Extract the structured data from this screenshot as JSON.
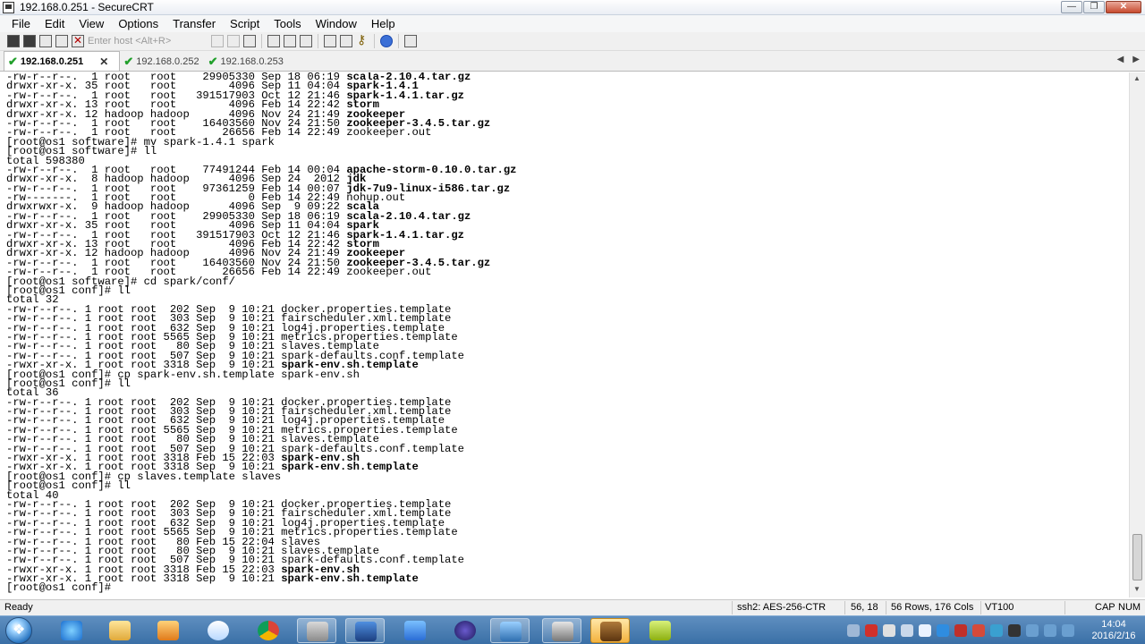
{
  "window": {
    "title": "192.168.0.251 - SecureCRT"
  },
  "window_controls": {
    "minimize": "—",
    "maximize": "❐",
    "close": "✕"
  },
  "menu": [
    "File",
    "Edit",
    "View",
    "Options",
    "Transfer",
    "Script",
    "Tools",
    "Window",
    "Help"
  ],
  "toolbar": {
    "host_placeholder": "Enter host <Alt+R>",
    "icons": [
      "connect-icon",
      "quick-connect-icon",
      "connect-in-tab-icon",
      "reconnect-icon",
      "disconnect-icon",
      "copy-icon",
      "paste-icon",
      "find-icon",
      "print-icon",
      "print-selection-icon",
      "print-setup-icon",
      "session-options-icon",
      "global-options-icon",
      "key-manager-icon",
      "help-icon",
      "map-icon"
    ]
  },
  "tabs": [
    {
      "label": "192.168.0.251",
      "active": true,
      "close": "✕"
    },
    {
      "label": "192.168.0.252",
      "active": false
    },
    {
      "label": "192.168.0.253",
      "active": false
    }
  ],
  "tab_nav": {
    "left": "◀",
    "right": "▶"
  },
  "terminal": {
    "lines": [
      [
        {
          "t": "-rw-r--r--.  1 root   root    29905330 Sep 18 06:19 "
        },
        {
          "t": "scala-2.10.4.tar.gz",
          "b": true
        }
      ],
      [
        {
          "t": "drwxr-xr-x. 35 root   root        4096 Sep 11 04:04 "
        },
        {
          "t": "spark-1.4.1",
          "b": true
        }
      ],
      [
        {
          "t": "-rw-r--r--.  1 root   root   391517903 Oct 12 21:46 "
        },
        {
          "t": "spark-1.4.1.tar.gz",
          "b": true
        }
      ],
      [
        {
          "t": "drwxr-xr-x. 13 root   root        4096 Feb 14 22:42 "
        },
        {
          "t": "storm",
          "b": true
        }
      ],
      [
        {
          "t": "drwxr-xr-x. 12 hadoop hadoop      4096 Nov 24 21:49 "
        },
        {
          "t": "zookeeper",
          "b": true
        }
      ],
      [
        {
          "t": "-rw-r--r--.  1 root   root    16403560 Nov 24 21:50 "
        },
        {
          "t": "zookeeper-3.4.5.tar.gz",
          "b": true
        }
      ],
      [
        {
          "t": "-rw-r--r--.  1 root   root       26656 Feb 14 22:49 zookeeper.out"
        }
      ],
      [
        {
          "t": "[root@os1 software]# mv spark-1.4.1 spark"
        }
      ],
      [
        {
          "t": "[root@os1 software]# ll"
        }
      ],
      [
        {
          "t": "total 598380"
        }
      ],
      [
        {
          "t": "-rw-r--r--.  1 root   root    77491244 Feb 14 00:04 "
        },
        {
          "t": "apache-storm-0.10.0.tar.gz",
          "b": true
        }
      ],
      [
        {
          "t": "drwxr-xr-x.  8 hadoop hadoop      4096 Sep 24  2012 "
        },
        {
          "t": "jdk",
          "b": true
        }
      ],
      [
        {
          "t": "-rw-r--r--.  1 root   root    97361259 Feb 14 00:07 "
        },
        {
          "t": "jdk-7u9-linux-i586.tar.gz",
          "b": true
        }
      ],
      [
        {
          "t": "-rw-------.  1 root   root           0 Feb 14 22:49 nohup.out"
        }
      ],
      [
        {
          "t": "drwxrwxr-x.  9 hadoop hadoop      4096 Sep  9 09:22 "
        },
        {
          "t": "scala",
          "b": true
        }
      ],
      [
        {
          "t": "-rw-r--r--.  1 root   root    29905330 Sep 18 06:19 "
        },
        {
          "t": "scala-2.10.4.tar.gz",
          "b": true
        }
      ],
      [
        {
          "t": "drwxr-xr-x. 35 root   root        4096 Sep 11 04:04 "
        },
        {
          "t": "spark",
          "b": true
        }
      ],
      [
        {
          "t": "-rw-r--r--.  1 root   root   391517903 Oct 12 21:46 "
        },
        {
          "t": "spark-1.4.1.tar.gz",
          "b": true
        }
      ],
      [
        {
          "t": "drwxr-xr-x. 13 root   root        4096 Feb 14 22:42 "
        },
        {
          "t": "storm",
          "b": true
        }
      ],
      [
        {
          "t": "drwxr-xr-x. 12 hadoop hadoop      4096 Nov 24 21:49 "
        },
        {
          "t": "zookeeper",
          "b": true
        }
      ],
      [
        {
          "t": "-rw-r--r--.  1 root   root    16403560 Nov 24 21:50 "
        },
        {
          "t": "zookeeper-3.4.5.tar.gz",
          "b": true
        }
      ],
      [
        {
          "t": "-rw-r--r--.  1 root   root       26656 Feb 14 22:49 zookeeper.out"
        }
      ],
      [
        {
          "t": "[root@os1 software]# cd spark/conf/"
        }
      ],
      [
        {
          "t": "[root@os1 conf]# ll"
        }
      ],
      [
        {
          "t": "total 32"
        }
      ],
      [
        {
          "t": "-rw-r--r--. 1 root root  202 Sep  9 10:21 docker.properties.template"
        }
      ],
      [
        {
          "t": "-rw-r--r--. 1 root root  303 Sep  9 10:21 fairscheduler.xml.template"
        }
      ],
      [
        {
          "t": "-rw-r--r--. 1 root root  632 Sep  9 10:21 log4j.properties.template"
        }
      ],
      [
        {
          "t": "-rw-r--r--. 1 root root 5565 Sep  9 10:21 metrics.properties.template"
        }
      ],
      [
        {
          "t": "-rw-r--r--. 1 root root   80 Sep  9 10:21 slaves.template"
        }
      ],
      [
        {
          "t": "-rw-r--r--. 1 root root  507 Sep  9 10:21 spark-defaults.conf.template"
        }
      ],
      [
        {
          "t": "-rwxr-xr-x. 1 root root 3318 Sep  9 10:21 "
        },
        {
          "t": "spark-env.sh.template",
          "b": true
        }
      ],
      [
        {
          "t": "[root@os1 conf]# cp spark-env.sh.template spark-env.sh"
        }
      ],
      [
        {
          "t": "[root@os1 conf]# ll"
        }
      ],
      [
        {
          "t": "total 36"
        }
      ],
      [
        {
          "t": "-rw-r--r--. 1 root root  202 Sep  9 10:21 docker.properties.template"
        }
      ],
      [
        {
          "t": "-rw-r--r--. 1 root root  303 Sep  9 10:21 fairscheduler.xml.template"
        }
      ],
      [
        {
          "t": "-rw-r--r--. 1 root root  632 Sep  9 10:21 log4j.properties.template"
        }
      ],
      [
        {
          "t": "-rw-r--r--. 1 root root 5565 Sep  9 10:21 metrics.properties.template"
        }
      ],
      [
        {
          "t": "-rw-r--r--. 1 root root   80 Sep  9 10:21 slaves.template"
        }
      ],
      [
        {
          "t": "-rw-r--r--. 1 root root  507 Sep  9 10:21 spark-defaults.conf.template"
        }
      ],
      [
        {
          "t": "-rwxr-xr-x. 1 root root 3318 Feb 15 22:03 "
        },
        {
          "t": "spark-env.sh",
          "b": true
        }
      ],
      [
        {
          "t": "-rwxr-xr-x. 1 root root 3318 Sep  9 10:21 "
        },
        {
          "t": "spark-env.sh.template",
          "b": true
        }
      ],
      [
        {
          "t": "[root@os1 conf]# cp slaves.template slaves"
        }
      ],
      [
        {
          "t": "[root@os1 conf]# ll"
        }
      ],
      [
        {
          "t": "total 40"
        }
      ],
      [
        {
          "t": "-rw-r--r--. 1 root root  202 Sep  9 10:21 docker.properties.template"
        }
      ],
      [
        {
          "t": "-rw-r--r--. 1 root root  303 Sep  9 10:21 fairscheduler.xml.template"
        }
      ],
      [
        {
          "t": "-rw-r--r--. 1 root root  632 Sep  9 10:21 log4j.properties.template"
        }
      ],
      [
        {
          "t": "-rw-r--r--. 1 root root 5565 Sep  9 10:21 metrics.properties.template"
        }
      ],
      [
        {
          "t": "-rw-r--r--. 1 root root   80 Feb 15 22:04 slaves"
        }
      ],
      [
        {
          "t": "-rw-r--r--. 1 root root   80 Sep  9 10:21 slaves.template"
        }
      ],
      [
        {
          "t": "-rw-r--r--. 1 root root  507 Sep  9 10:21 spark-defaults.conf.template"
        }
      ],
      [
        {
          "t": "-rwxr-xr-x. 1 root root 3318 Feb 15 22:03 "
        },
        {
          "t": "spark-env.sh",
          "b": true
        }
      ],
      [
        {
          "t": "-rwxr-xr-x. 1 root root 3318 Sep  9 10:21 "
        },
        {
          "t": "spark-env.sh.template",
          "b": true
        }
      ],
      [
        {
          "t": "[root@os1 conf]# "
        }
      ]
    ]
  },
  "statusbar": {
    "ready": "Ready",
    "protocol": "ssh2: AES-256-CTR",
    "cursor": "56, 18",
    "size": "56 Rows, 176 Cols",
    "emulation": "VT100",
    "caps": "CAP",
    "num": "NUM"
  },
  "taskbar": {
    "apps": [
      "internet-explorer-icon",
      "file-explorer-icon",
      "media-player-icon",
      "network-app-icon",
      "chrome-icon",
      "securecrt-folder-icon",
      "remote-app-icon",
      "paint-app-icon",
      "eclipse-icon",
      "virtualbox-icon",
      "securecrt-icon",
      "character-app-icon",
      "mybase-icon"
    ],
    "clock_time": "14:04",
    "clock_date": "2016/2/16"
  },
  "colors": {
    "title_bar": "#eaeef4",
    "taskbar": "#3a6fa6",
    "tab_check": "#22a02c"
  }
}
